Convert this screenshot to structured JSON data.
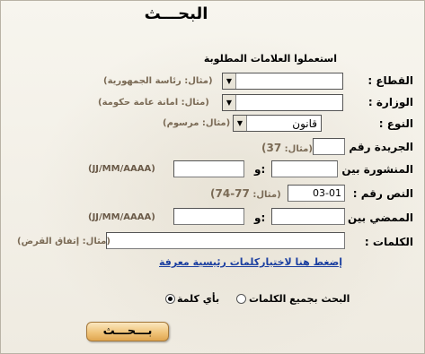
{
  "title": "البحـــث",
  "subtitle": "استعملوا العلامات المطلوبة",
  "fields": {
    "sector": {
      "label": "القطاع :",
      "hint": "(مثال: رئاسة الجمهورية)",
      "value": ""
    },
    "ministry": {
      "label": "الوزارة :",
      "hint": "(مثال: امانة عامة حكومة)",
      "value": ""
    },
    "type": {
      "label": "النوع :",
      "hint": "(مثال: مرسوم)",
      "value": "قانون"
    },
    "journal_number": {
      "label": "الجريدة رقم :",
      "hint_prefix": "(مثال:",
      "hint_value": "37)",
      "value": ""
    },
    "published_between": {
      "label": "المنشورة بين :",
      "and": "و:",
      "hint": "(JJ/MM/AAAA)",
      "from": "",
      "to": ""
    },
    "text_number": {
      "label": "النص رقم :",
      "hint_prefix": "(مثال:",
      "hint_value": "77-74)",
      "value": "03-01"
    },
    "signed_between": {
      "label": "الممضي بين :",
      "and": "و:",
      "hint": "(JJ/MM/AAAA)",
      "from": "",
      "to": ""
    },
    "keywords": {
      "label": "الكلمات :",
      "hint": "(مثال: إتفاق القرض)",
      "value": ""
    }
  },
  "keywords_link": "إضغط هنا لاختياركلمات رئيسية معرفة",
  "search_mode": {
    "all_words": "البحث بجميع الكلمات",
    "any_word": "بأي كلمة",
    "selected": "any_word"
  },
  "search_button": "بـــحـــث"
}
